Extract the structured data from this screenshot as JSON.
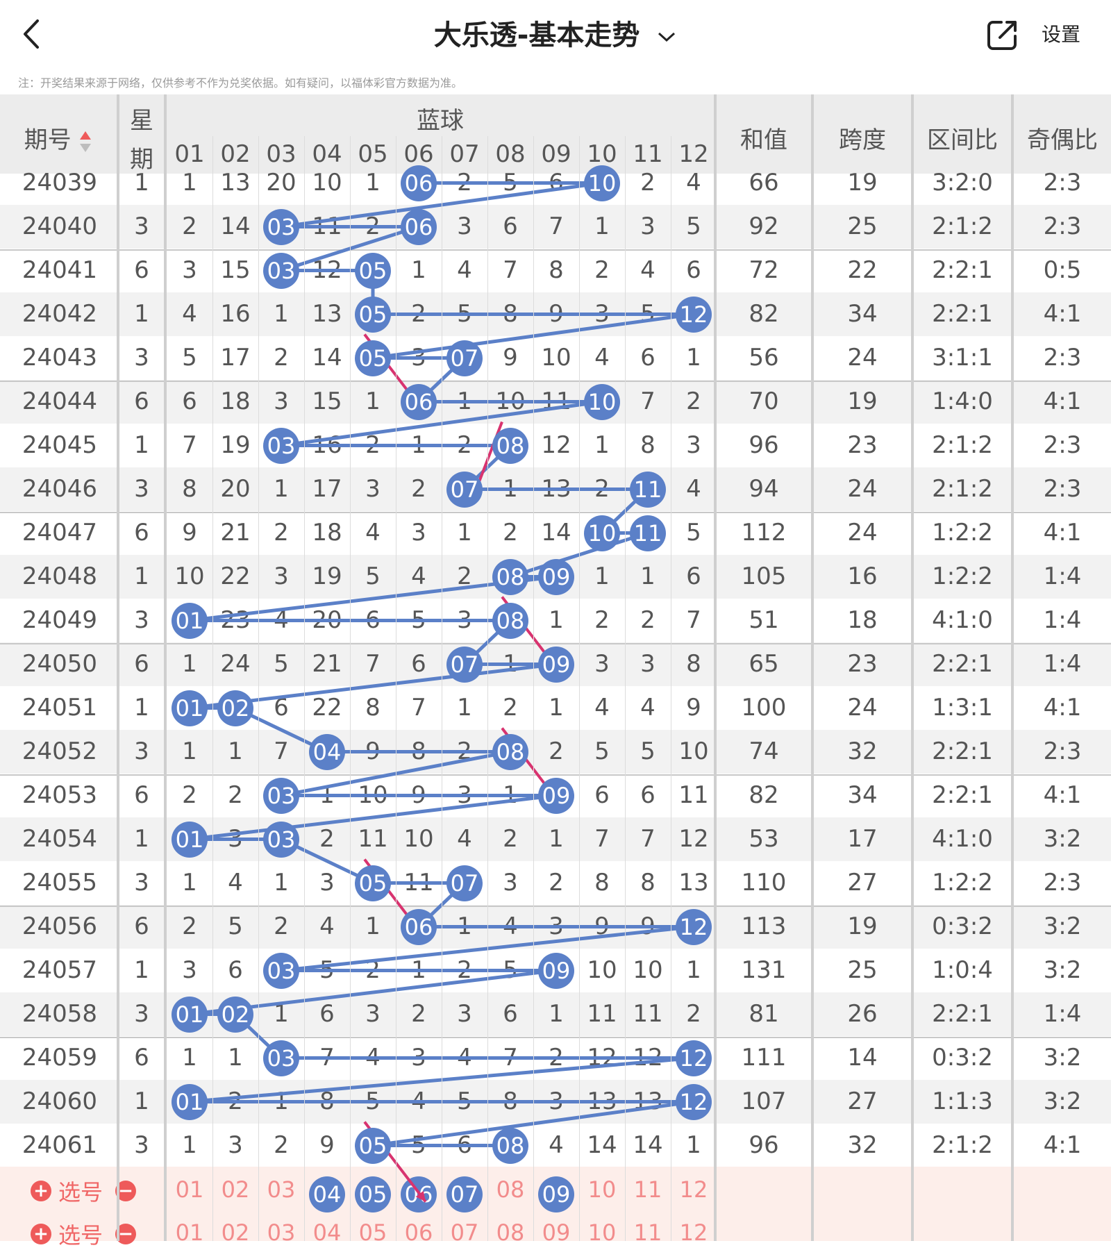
{
  "topbar": {
    "title": "大乐透-基本走势",
    "settings_label": "设置"
  },
  "notice": "注：开奖结果来源于网络，仅供参考不作为兑奖依据。如有疑问，以福体彩官方数据为准。",
  "header": {
    "period": "期号",
    "weekday_top": "星",
    "weekday_bottom": "期",
    "blue_ball": "蓝球",
    "numbers": [
      "01",
      "02",
      "03",
      "04",
      "05",
      "06",
      "07",
      "08",
      "09",
      "10",
      "11",
      "12"
    ],
    "sum": "和值",
    "span": "跨度",
    "interval_ratio": "区间比",
    "odd_even_ratio": "奇偶比"
  },
  "rows": [
    {
      "period": "24039",
      "week": "1",
      "cells": [
        "1",
        "13",
        "20",
        "10",
        "1",
        "06",
        "2",
        "5",
        "6",
        "10",
        "2",
        "4"
      ],
      "balls": [
        6,
        10
      ],
      "sum": "66",
      "span": "19",
      "interval": "3:2:0",
      "oe": "2:3"
    },
    {
      "period": "24040",
      "week": "3",
      "cells": [
        "2",
        "14",
        "03",
        "11",
        "2",
        "06",
        "3",
        "6",
        "7",
        "1",
        "3",
        "5"
      ],
      "balls": [
        3,
        6
      ],
      "sum": "92",
      "span": "25",
      "interval": "2:1:2",
      "oe": "2:3"
    },
    {
      "period": "24041",
      "week": "6",
      "cells": [
        "3",
        "15",
        "03",
        "12",
        "05",
        "1",
        "4",
        "7",
        "8",
        "2",
        "4",
        "6"
      ],
      "balls": [
        3,
        5
      ],
      "sum": "72",
      "span": "22",
      "interval": "2:2:1",
      "oe": "0:5"
    },
    {
      "period": "24042",
      "week": "1",
      "cells": [
        "4",
        "16",
        "1",
        "13",
        "05",
        "2",
        "5",
        "8",
        "9",
        "3",
        "5",
        "12"
      ],
      "balls": [
        5,
        12
      ],
      "sum": "82",
      "span": "34",
      "interval": "2:2:1",
      "oe": "4:1"
    },
    {
      "period": "24043",
      "week": "3",
      "cells": [
        "5",
        "17",
        "2",
        "14",
        "05",
        "3",
        "07",
        "9",
        "10",
        "4",
        "6",
        "1"
      ],
      "balls": [
        5,
        7
      ],
      "sum": "56",
      "span": "24",
      "interval": "3:1:1",
      "oe": "2:3"
    },
    {
      "period": "24044",
      "week": "6",
      "cells": [
        "6",
        "18",
        "3",
        "15",
        "1",
        "06",
        "1",
        "10",
        "11",
        "10",
        "7",
        "2"
      ],
      "balls": [
        6,
        10
      ],
      "sum": "70",
      "span": "19",
      "interval": "1:4:0",
      "oe": "4:1"
    },
    {
      "period": "24045",
      "week": "1",
      "cells": [
        "7",
        "19",
        "03",
        "16",
        "2",
        "1",
        "2",
        "08",
        "12",
        "1",
        "8",
        "3"
      ],
      "balls": [
        3,
        8
      ],
      "sum": "96",
      "span": "23",
      "interval": "2:1:2",
      "oe": "2:3"
    },
    {
      "period": "24046",
      "week": "3",
      "cells": [
        "8",
        "20",
        "1",
        "17",
        "3",
        "2",
        "07",
        "1",
        "13",
        "2",
        "11",
        "4"
      ],
      "balls": [
        7,
        11
      ],
      "sum": "94",
      "span": "24",
      "interval": "2:1:2",
      "oe": "2:3"
    },
    {
      "period": "24047",
      "week": "6",
      "cells": [
        "9",
        "21",
        "2",
        "18",
        "4",
        "3",
        "1",
        "2",
        "14",
        "10",
        "11",
        "5"
      ],
      "balls": [
        10,
        11
      ],
      "sum": "112",
      "span": "24",
      "interval": "1:2:2",
      "oe": "4:1"
    },
    {
      "period": "24048",
      "week": "1",
      "cells": [
        "10",
        "22",
        "3",
        "19",
        "5",
        "4",
        "2",
        "08",
        "09",
        "1",
        "1",
        "6"
      ],
      "balls": [
        8,
        9
      ],
      "sum": "105",
      "span": "16",
      "interval": "1:2:2",
      "oe": "1:4"
    },
    {
      "period": "24049",
      "week": "3",
      "cells": [
        "01",
        "23",
        "4",
        "20",
        "6",
        "5",
        "3",
        "08",
        "1",
        "2",
        "2",
        "7"
      ],
      "balls": [
        1,
        8
      ],
      "sum": "51",
      "span": "18",
      "interval": "4:1:0",
      "oe": "1:4"
    },
    {
      "period": "24050",
      "week": "6",
      "cells": [
        "1",
        "24",
        "5",
        "21",
        "7",
        "6",
        "07",
        "1",
        "09",
        "3",
        "3",
        "8"
      ],
      "balls": [
        7,
        9
      ],
      "sum": "65",
      "span": "23",
      "interval": "2:2:1",
      "oe": "1:4"
    },
    {
      "period": "24051",
      "week": "1",
      "cells": [
        "01",
        "02",
        "6",
        "22",
        "8",
        "7",
        "1",
        "2",
        "1",
        "4",
        "4",
        "9"
      ],
      "balls": [
        1,
        2
      ],
      "sum": "100",
      "span": "24",
      "interval": "1:3:1",
      "oe": "4:1"
    },
    {
      "period": "24052",
      "week": "3",
      "cells": [
        "1",
        "1",
        "7",
        "04",
        "9",
        "8",
        "2",
        "08",
        "2",
        "5",
        "5",
        "10"
      ],
      "balls": [
        4,
        8
      ],
      "sum": "74",
      "span": "32",
      "interval": "2:2:1",
      "oe": "2:3"
    },
    {
      "period": "24053",
      "week": "6",
      "cells": [
        "2",
        "2",
        "03",
        "1",
        "10",
        "9",
        "3",
        "1",
        "09",
        "6",
        "6",
        "11"
      ],
      "balls": [
        3,
        9
      ],
      "sum": "82",
      "span": "34",
      "interval": "2:2:1",
      "oe": "4:1"
    },
    {
      "period": "24054",
      "week": "1",
      "cells": [
        "01",
        "3",
        "03",
        "2",
        "11",
        "10",
        "4",
        "2",
        "1",
        "7",
        "7",
        "12"
      ],
      "balls": [
        1,
        3
      ],
      "sum": "53",
      "span": "17",
      "interval": "4:1:0",
      "oe": "3:2"
    },
    {
      "period": "24055",
      "week": "3",
      "cells": [
        "1",
        "4",
        "1",
        "3",
        "05",
        "11",
        "07",
        "3",
        "2",
        "8",
        "8",
        "13"
      ],
      "balls": [
        5,
        7
      ],
      "sum": "110",
      "span": "27",
      "interval": "1:2:2",
      "oe": "2:3"
    },
    {
      "period": "24056",
      "week": "6",
      "cells": [
        "2",
        "5",
        "2",
        "4",
        "1",
        "06",
        "1",
        "4",
        "3",
        "9",
        "9",
        "12"
      ],
      "balls": [
        6,
        12
      ],
      "sum": "113",
      "span": "19",
      "interval": "0:3:2",
      "oe": "3:2"
    },
    {
      "period": "24057",
      "week": "1",
      "cells": [
        "3",
        "6",
        "03",
        "5",
        "2",
        "1",
        "2",
        "5",
        "09",
        "10",
        "10",
        "1"
      ],
      "balls": [
        3,
        9
      ],
      "sum": "131",
      "span": "25",
      "interval": "1:0:4",
      "oe": "3:2"
    },
    {
      "period": "24058",
      "week": "3",
      "cells": [
        "01",
        "02",
        "1",
        "6",
        "3",
        "2",
        "3",
        "6",
        "1",
        "11",
        "11",
        "2"
      ],
      "balls": [
        1,
        2
      ],
      "sum": "81",
      "span": "26",
      "interval": "2:2:1",
      "oe": "1:4"
    },
    {
      "period": "24059",
      "week": "6",
      "cells": [
        "1",
        "1",
        "03",
        "7",
        "4",
        "3",
        "4",
        "7",
        "2",
        "12",
        "12",
        "12"
      ],
      "balls": [
        3,
        12
      ],
      "sum": "111",
      "span": "14",
      "interval": "0:3:2",
      "oe": "3:2"
    },
    {
      "period": "24060",
      "week": "1",
      "cells": [
        "01",
        "2",
        "1",
        "8",
        "5",
        "4",
        "5",
        "8",
        "3",
        "13",
        "13",
        "12"
      ],
      "balls": [
        1,
        12
      ],
      "sum": "107",
      "span": "27",
      "interval": "1:1:3",
      "oe": "3:2"
    },
    {
      "period": "24061",
      "week": "3",
      "cells": [
        "1",
        "3",
        "2",
        "9",
        "05",
        "5",
        "6",
        "08",
        "4",
        "14",
        "14",
        "1"
      ],
      "balls": [
        5,
        8
      ],
      "sum": "96",
      "span": "32",
      "interval": "2:1:2",
      "oe": "4:1"
    }
  ],
  "selection": {
    "label": "选号",
    "row1_selected": [
      4,
      5,
      6,
      7,
      9
    ],
    "numbers": [
      "01",
      "02",
      "03",
      "04",
      "05",
      "06",
      "07",
      "08",
      "09",
      "10",
      "11",
      "12"
    ]
  },
  "colors": {
    "ball": "#5b80c8",
    "line": "#5b80c8",
    "arrow": "#d8336f",
    "select_bg": "#fdeeea",
    "select_text": "#f28c8c"
  }
}
